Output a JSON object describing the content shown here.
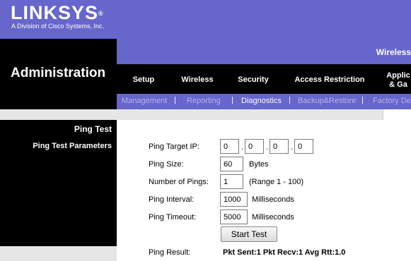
{
  "brand": {
    "logo": "LINKSYS",
    "registered_mark": "®",
    "tagline": "A Division of Cisco Systems, Inc."
  },
  "header": {
    "title": "Administration",
    "product": "Wireless"
  },
  "main_nav": {
    "tabs": [
      "Setup",
      "Wireless",
      "Security",
      "Access Restriction"
    ],
    "applications_line1": "Applic",
    "applications_line2": "& Ga"
  },
  "sub_nav": {
    "tabs": [
      "Management",
      "Reporting",
      "Diagnostics",
      "Backup&Restore",
      "Factory De"
    ],
    "separator": "|",
    "active": "Diagnostics"
  },
  "sidebar": {
    "section_title": "Ping Test",
    "item": "Ping Test Parameters"
  },
  "form": {
    "target_ip_label": "Ping Target IP:",
    "ip_octets": [
      "0",
      "0",
      "0",
      "0"
    ],
    "ip_dot": ".",
    "size_label": "Ping Size:",
    "size_value": "60",
    "size_unit": "Bytes",
    "count_label": "Number of Pings:",
    "count_value": "1",
    "count_range": "(Range 1 - 100)",
    "interval_label": "Ping Interval:",
    "interval_value": "1000",
    "interval_unit": "Milliseconds",
    "timeout_label": "Ping Timeout:",
    "timeout_value": "5000",
    "timeout_unit": "Milliseconds",
    "start_button": "Start Test",
    "result_label": "Ping Result:",
    "result_value": "Pkt Sent:1 Pkt Recv:1 Avg Rtt:1.0"
  },
  "colors": {
    "brand_purple": "#6666cc",
    "nav_black": "#000000",
    "inactive_subtab": "#b4b4e8",
    "panel_gray": "#e6e6e6"
  }
}
